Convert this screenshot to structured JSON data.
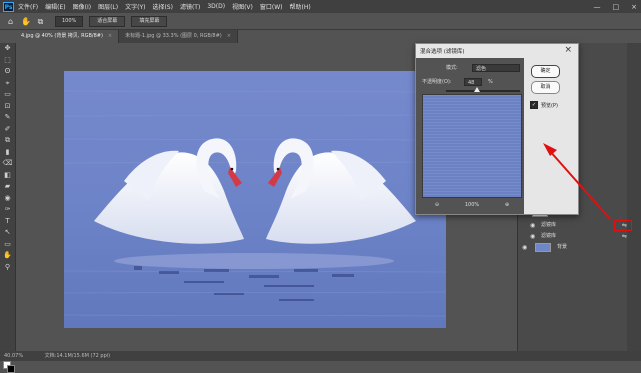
{
  "app": {
    "logo": "Ps"
  },
  "menu": [
    "文件(F)",
    "编辑(E)",
    "图像(I)",
    "图层(L)",
    "文字(Y)",
    "选择(S)",
    "滤镜(T)",
    "3D(D)",
    "视图(V)",
    "窗口(W)",
    "帮助(H)"
  ],
  "window_controls": [
    "—",
    "□",
    "×"
  ],
  "options_bar": {
    "zoom_value": "100%",
    "fit_screen": "适合屏幕",
    "fill_screen": "填充屏幕"
  },
  "tabs": [
    {
      "label": "4.jpg @ 40% (背景 拷贝, RGB/8#)",
      "close": "×"
    },
    {
      "label": "未标题-1.jpg @ 33.3% (图层 0, RGB/8#)",
      "close": "×"
    }
  ],
  "tools": [
    "✥",
    "⬚",
    "ʘ",
    "⌖",
    "▭",
    "⊡",
    "✎",
    "✐",
    "⧉",
    "▮",
    "⌫",
    "◧",
    "▰",
    "◉",
    "✑",
    "T",
    "↖",
    "▭",
    "✋",
    "⚲"
  ],
  "status": {
    "zoom": "40.07%",
    "doc_info": "文档:14.1M/15.6M (72 ppi)"
  },
  "dialog": {
    "title": "混合选项 (滤镜库)",
    "close": "×",
    "mode_label": "模式:",
    "mode_value": "滤色",
    "opacity_label": "不透明度(O):",
    "opacity_value": "48",
    "opacity_unit": "%",
    "ok": "确定",
    "cancel": "取消",
    "preview_label": "预览(P)",
    "preview_checked": "✓",
    "zoom": "100%",
    "zoom_out": "⊖",
    "zoom_in": "⊕"
  },
  "layers": {
    "smart_filters": "智能滤镜",
    "filter_row_1": "滤镜库",
    "filter_row_2": "滤镜库",
    "background": "背景",
    "eye": "◉",
    "fx": "⇋"
  },
  "colors": {
    "accent": "#31a8ff",
    "arrow": "#e01010",
    "preview_blue": "#6f86c9"
  }
}
